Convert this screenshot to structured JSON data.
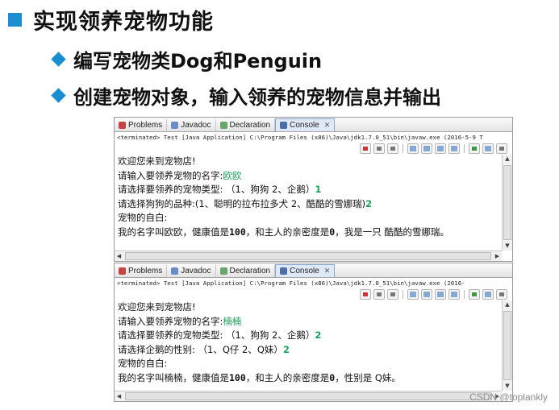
{
  "slide": {
    "title": "实现领养宠物功能",
    "bullet1": "编写宠物类Dog和Penguin",
    "bullet2": "创建宠物对象，输入领养的宠物信息并输出"
  },
  "console1": {
    "tabs": {
      "problems": "Problems",
      "javadoc": "Javadoc",
      "declaration": "Declaration",
      "console": "Console"
    },
    "status": "<terminated> Test [Java Application] C:\\Program Files (x86)\\Java\\jdk1.7.0_51\\bin\\javaw.exe (2016-5-9 T",
    "l1": "欢迎您来到宠物店!",
    "l2_prompt": "请输入要领养宠物的名字:",
    "l2_input": "欧欧",
    "l3_prompt": "请选择要领养的宠物类型: （1、狗狗 2、企鹅）",
    "l3_input": "1",
    "l4_prompt": "请选择狗狗的品种:(1、聪明的拉布拉多犬 2、酷酷的雪娜瑞)",
    "l4_input": "2",
    "l5": "宠物的自白:",
    "l6_a": "我的名字叫欧欧，健康值是",
    "l6_n1": "100",
    "l6_b": "，和主人的亲密度是",
    "l6_n2": "0",
    "l6_c": "，我是一只 酷酷的雪娜瑞。"
  },
  "console2": {
    "tabs": {
      "problems": "Problems",
      "javadoc": "Javadoc",
      "declaration": "Declaration",
      "console": "Console"
    },
    "status": "<terminated> Test [Java Application] C:\\Program Files (x86)\\Java\\jdk1.7.0_51\\bin\\javaw.exe (2016-",
    "l1": "欢迎您来到宠物店!",
    "l2_prompt": "请输入要领养宠物的名字:",
    "l2_input": "楠楠",
    "l3_prompt": "请选择要领养的宠物类型: （1、狗狗 2、企鹅）",
    "l3_input": "2",
    "l4_prompt": "请选择企鹅的性别: （1、Q仔 2、Q妹）",
    "l4_input": "2",
    "l5": "宠物的自白:",
    "l6_a": "我的名字叫楠楠，健康值是",
    "l6_n1": "100",
    "l6_b": "，和主人的亲密度是",
    "l6_n2": "0",
    "l6_c": "，性别是 Q妹。"
  },
  "watermark": "CSDN @toplankly",
  "colors": {
    "accent": "#1a8fd0",
    "input": "#19a15c"
  }
}
